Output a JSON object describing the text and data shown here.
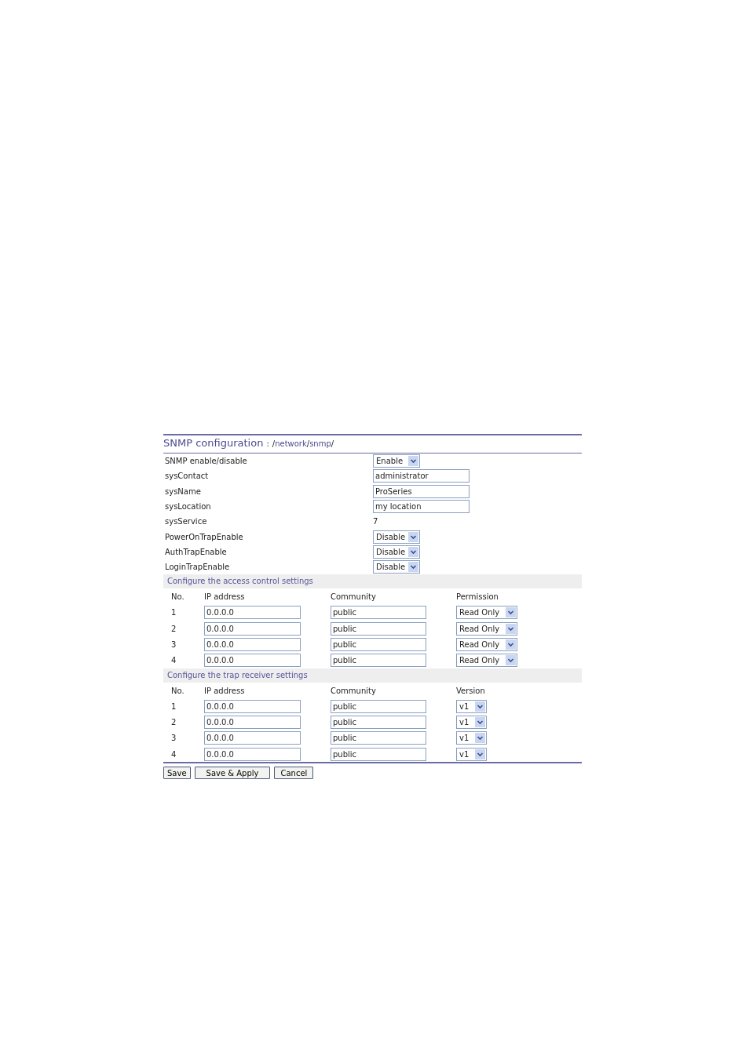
{
  "title": "SNMP configuration",
  "path_separator": ":",
  "path": [
    {
      "text": "/",
      "kind": "plain"
    },
    {
      "text": "network",
      "kind": "link"
    },
    {
      "text": "/",
      "kind": "plain"
    },
    {
      "text": "snmp",
      "kind": "link"
    },
    {
      "text": "/",
      "kind": "plain"
    }
  ],
  "settings": [
    {
      "label": "SNMP enable/disable",
      "kind": "select",
      "value": "Enable"
    },
    {
      "label": "sysContact",
      "kind": "text",
      "value": "administrator"
    },
    {
      "label": "sysName",
      "kind": "text",
      "value": "ProSeries"
    },
    {
      "label": "sysLocation",
      "kind": "text",
      "value": "my location"
    },
    {
      "label": "sysService",
      "kind": "static",
      "value": "7"
    },
    {
      "label": "PowerOnTrapEnable",
      "kind": "select",
      "value": "Disable"
    },
    {
      "label": "AuthTrapEnable",
      "kind": "select",
      "value": "Disable"
    },
    {
      "label": "LoginTrapEnable",
      "kind": "select",
      "value": "Disable"
    }
  ],
  "sections": [
    {
      "heading": "Configure the access control settings",
      "columns": [
        "No.",
        "IP address",
        "Community",
        "Permission"
      ],
      "rows": [
        {
          "no": "1",
          "ip": "0.0.0.0",
          "community": "public",
          "option": "Read Only"
        },
        {
          "no": "2",
          "ip": "0.0.0.0",
          "community": "public",
          "option": "Read Only"
        },
        {
          "no": "3",
          "ip": "0.0.0.0",
          "community": "public",
          "option": "Read Only"
        },
        {
          "no": "4",
          "ip": "0.0.0.0",
          "community": "public",
          "option": "Read Only"
        }
      ]
    },
    {
      "heading": "Configure the trap receiver settings",
      "columns": [
        "No.",
        "IP address",
        "Community",
        "Version"
      ],
      "rows": [
        {
          "no": "1",
          "ip": "0.0.0.0",
          "community": "public",
          "option": "v1"
        },
        {
          "no": "2",
          "ip": "0.0.0.0",
          "community": "public",
          "option": "v1"
        },
        {
          "no": "3",
          "ip": "0.0.0.0",
          "community": "public",
          "option": "v1"
        },
        {
          "no": "4",
          "ip": "0.0.0.0",
          "community": "public",
          "option": "v1"
        }
      ]
    }
  ],
  "buttons": [
    "Save",
    "Save & Apply",
    "Cancel"
  ]
}
